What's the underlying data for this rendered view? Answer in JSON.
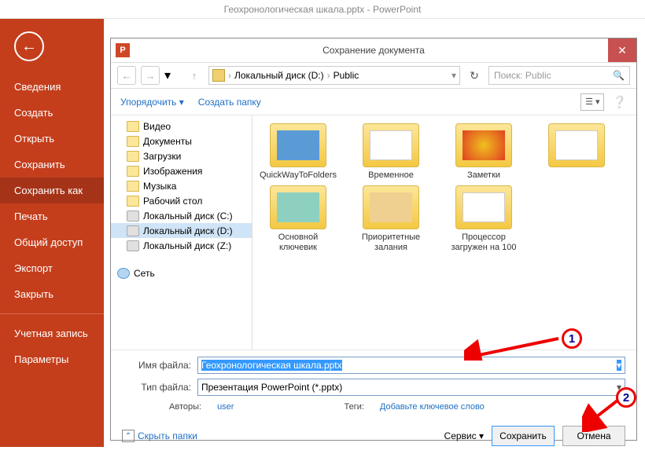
{
  "app_title": "Геохронологическая шкала.pptx - PowerPoint",
  "sidebar": {
    "items": [
      {
        "label": "Сведения"
      },
      {
        "label": "Создать"
      },
      {
        "label": "Открыть"
      },
      {
        "label": "Сохранить"
      },
      {
        "label": "Сохранить как",
        "active": true
      },
      {
        "label": "Печать"
      },
      {
        "label": "Общий доступ"
      },
      {
        "label": "Экспорт"
      },
      {
        "label": "Закрыть"
      }
    ],
    "lower": [
      {
        "label": "Учетная запись"
      },
      {
        "label": "Параметры"
      }
    ]
  },
  "dialog": {
    "title": "Сохранение документа",
    "icon_text": "P",
    "nav": {
      "breadcrumb": [
        "Локальный диск (D:)",
        "Public"
      ],
      "search_placeholder": "Поиск: Public"
    },
    "toolbar": {
      "organize": "Упорядочить",
      "new_folder": "Создать папку"
    },
    "tree": [
      {
        "label": "Видео",
        "icon": "folder"
      },
      {
        "label": "Документы",
        "icon": "folder"
      },
      {
        "label": "Загрузки",
        "icon": "folder"
      },
      {
        "label": "Изображения",
        "icon": "folder"
      },
      {
        "label": "Музыка",
        "icon": "folder"
      },
      {
        "label": "Рабочий стол",
        "icon": "folder"
      },
      {
        "label": "Локальный диск (C:)",
        "icon": "disk"
      },
      {
        "label": "Локальный диск (D:)",
        "icon": "disk",
        "active": true
      },
      {
        "label": "Локальный диск (Z:)",
        "icon": "disk"
      },
      {
        "label": "Сеть",
        "icon": "net",
        "gap": true
      }
    ],
    "folders": [
      {
        "label": "QuickWayToFolders"
      },
      {
        "label": "Временное"
      },
      {
        "label": "Заметки"
      },
      {
        "label": "Основной ключевик"
      },
      {
        "label": "Приоритетные залания"
      },
      {
        "label": "Процессор загружен на 100"
      }
    ],
    "form": {
      "filename_label": "Имя файла:",
      "filename_value": "Геохронологическая шкала.pptx",
      "filetype_label": "Тип файла:",
      "filetype_value": "Презентация PowerPoint (*.pptx)",
      "authors_label": "Авторы:",
      "authors_value": "user",
      "tags_label": "Теги:",
      "tags_value": "Добавьте ключевое слово"
    },
    "footer": {
      "hide_folders": "Скрыть папки",
      "service": "Сервис",
      "save": "Сохранить",
      "cancel": "Отмена"
    }
  },
  "annotations": {
    "one": "1",
    "two": "2"
  }
}
